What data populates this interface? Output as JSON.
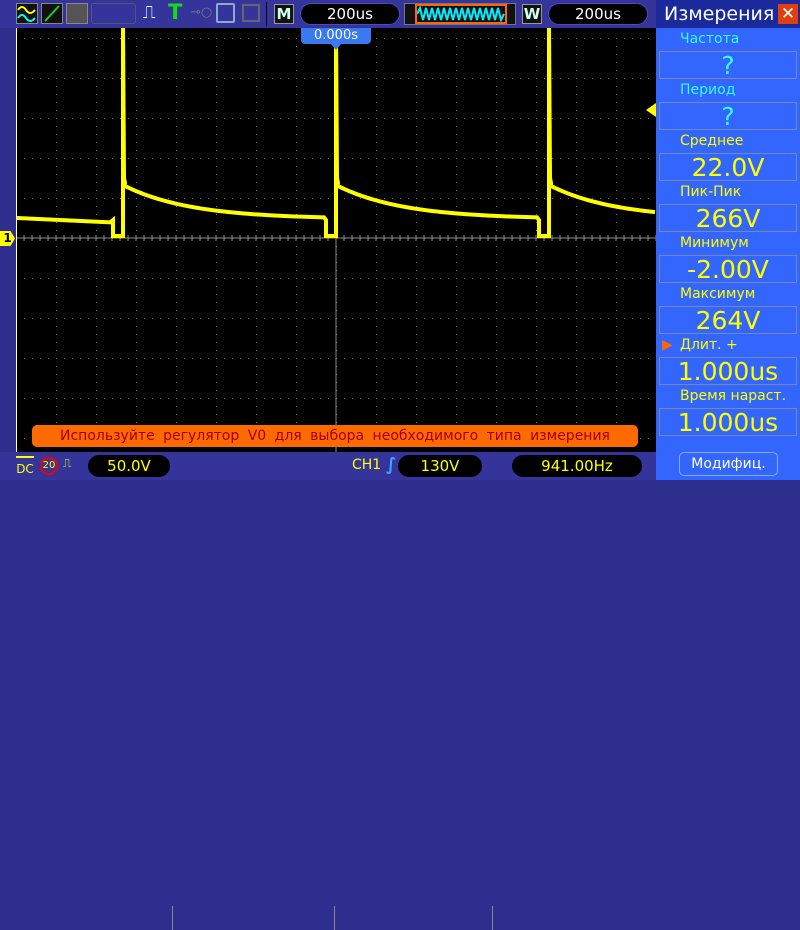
{
  "toolbar": {
    "timebase": "200us",
    "window_timebase": "200us",
    "m_label": "M",
    "w_label": "W",
    "trigger_time": "0.000s"
  },
  "panel": {
    "title": "Измерения",
    "close": "✕",
    "items": [
      {
        "label": "Частота",
        "value": "?",
        "color": "#33ffff"
      },
      {
        "label": "Период",
        "value": "?",
        "color": "#33ffff"
      },
      {
        "label": "Среднее",
        "value": "22.0V",
        "color": "#ffff00"
      },
      {
        "label": "Пик-Пик",
        "value": "266V",
        "color": "#ffff00"
      },
      {
        "label": "Минимум",
        "value": "-2.00V",
        "color": "#ffff00"
      },
      {
        "label": "Максимум",
        "value": "264V",
        "color": "#ffff00"
      },
      {
        "label": "Длит.  +",
        "value": "1.000us",
        "color": "#ffff00",
        "selected": true
      },
      {
        "label": "Время  нараст.",
        "value": "1.000us",
        "color": "#ffff00"
      }
    ],
    "modify": "Модифиц."
  },
  "message": "Используйте регулятор V0 для выбора необходимого типа измерения",
  "status": {
    "coupling": "DC",
    "bw_limit": "20",
    "ch_scale": "50.0V",
    "trig_source": "CH1",
    "trig_level": "130V",
    "frequency": "941.00Hz"
  },
  "channel_marker": "1",
  "colors": {
    "trace": "#ffff00",
    "accent": "#ff6a00"
  }
}
